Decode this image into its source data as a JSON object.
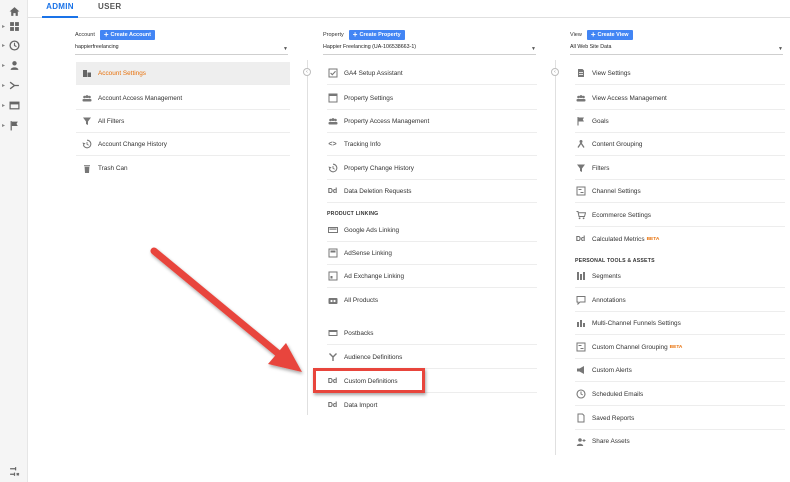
{
  "tabs": [
    {
      "label": "ADMIN"
    },
    {
      "label": "USER"
    }
  ],
  "account": {
    "header_label": "Account",
    "create_label": "Create Account",
    "selected": "happierfreelancing",
    "items": [
      {
        "label": "Account Settings"
      },
      {
        "label": "Account Access Management"
      },
      {
        "label": "All Filters"
      },
      {
        "label": "Account Change History"
      },
      {
        "label": "Trash Can"
      }
    ]
  },
  "property": {
    "header_label": "Property",
    "create_label": "Create Property",
    "selected": "Happier Freelancing (UA-106538663-1)",
    "items": [
      {
        "label": "GA4 Setup Assistant"
      },
      {
        "label": "Property Settings"
      },
      {
        "label": "Property Access Management"
      },
      {
        "label": "Tracking Info"
      },
      {
        "label": "Property Change History"
      },
      {
        "label": "Data Deletion Requests"
      }
    ],
    "section_label": "PRODUCT LINKING",
    "linking_items": [
      {
        "label": "Google Ads Linking"
      },
      {
        "label": "AdSense Linking"
      },
      {
        "label": "Ad Exchange Linking"
      },
      {
        "label": "All Products"
      }
    ],
    "extra_items": [
      {
        "label": "Postbacks"
      },
      {
        "label": "Audience Definitions"
      },
      {
        "label": "Custom Definitions"
      },
      {
        "label": "Data Import"
      }
    ]
  },
  "view": {
    "header_label": "View",
    "create_label": "Create View",
    "selected": "All Web Site Data",
    "items": [
      {
        "label": "View Settings"
      },
      {
        "label": "View Access Management"
      },
      {
        "label": "Goals"
      },
      {
        "label": "Content Grouping"
      },
      {
        "label": "Filters"
      },
      {
        "label": "Channel Settings"
      },
      {
        "label": "Ecommerce Settings"
      },
      {
        "label": "Calculated Metrics",
        "badge": "BETA"
      }
    ],
    "section_label": "PERSONAL TOOLS & ASSETS",
    "personal_items": [
      {
        "label": "Segments"
      },
      {
        "label": "Annotations"
      },
      {
        "label": "Multi-Channel Funnels Settings"
      },
      {
        "label": "Custom Channel Grouping",
        "badge": "BETA"
      },
      {
        "label": "Custom Alerts"
      },
      {
        "label": "Scheduled Emails"
      },
      {
        "label": "Saved Reports"
      },
      {
        "label": "Share Assets"
      }
    ]
  },
  "icons": {
    "dd_glyph": "Dd",
    "code_glyph": "<>"
  },
  "colors": {
    "accent": "#1a73e8",
    "button": "#4285f4",
    "selected_text": "#e8710a",
    "highlight": "#e8453c"
  }
}
